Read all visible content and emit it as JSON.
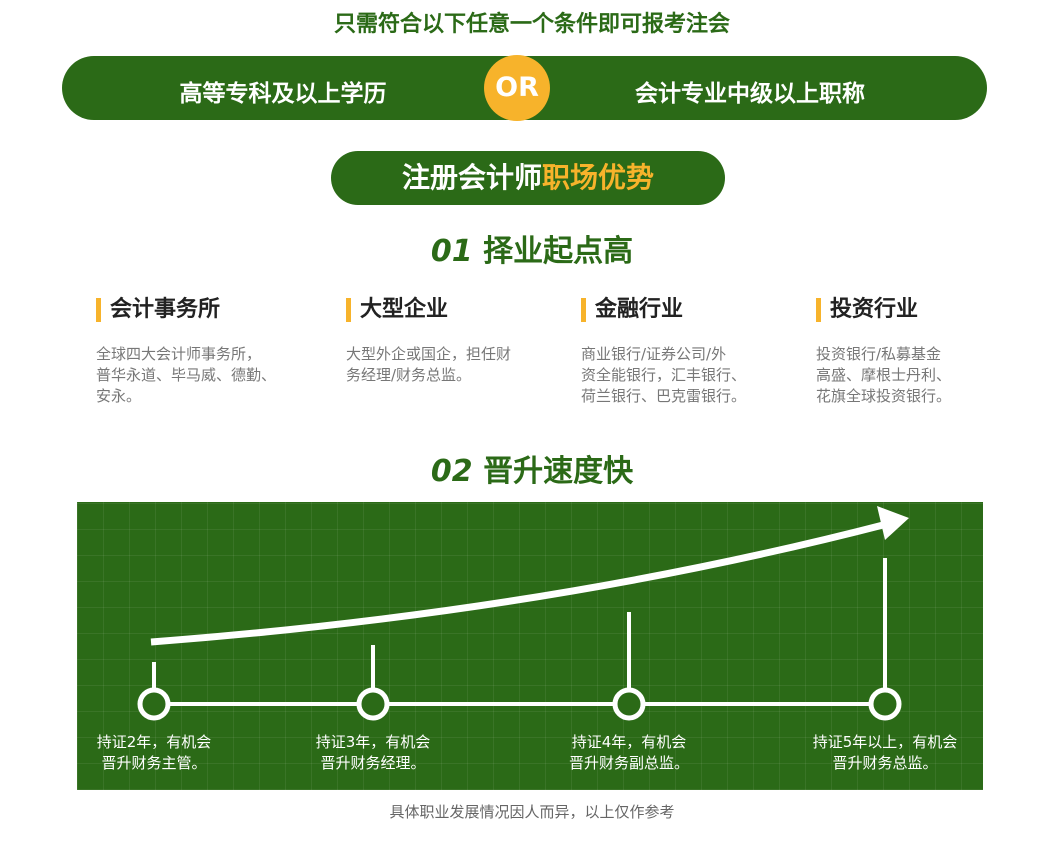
{
  "conditions": {
    "intro": "只需符合以下任意一个条件即可报考注会",
    "left": "高等专科及以上学历",
    "or": "OR",
    "right": "会计专业中级以上职称"
  },
  "section": {
    "pill_white": "注册会计师",
    "pill_yellow": "职场优势"
  },
  "advantage1": {
    "num": "01",
    "title": "择业起点高",
    "columns": [
      {
        "title": "会计事务所",
        "desc": [
          "全球四大会计师事务所，",
          "普华永道、毕马威、德勤、",
          "安永。"
        ]
      },
      {
        "title": "大型企业",
        "desc": [
          "大型外企或国企，担任财",
          "务经理/财务总监。"
        ]
      },
      {
        "title": "金融行业",
        "desc": [
          "商业银行/证券公司/外",
          "资全能银行，汇丰银行、",
          "荷兰银行、巴克雷银行。"
        ]
      },
      {
        "title": "投资行业",
        "desc": [
          "投资银行/私募基金",
          "高盛、摩根士丹利、",
          "花旗全球投资银行。"
        ]
      }
    ]
  },
  "advantage2": {
    "num": "02",
    "title": "晋升速度快",
    "stages": [
      {
        "line1": "持证2年，有机会",
        "line2": "晋升财务主管。"
      },
      {
        "line1": "持证3年，有机会",
        "line2": "晋升财务经理。"
      },
      {
        "line1": "持证4年，有机会",
        "line2": "晋升财务副总监。"
      },
      {
        "line1": "持证5年以上，有机会",
        "line2": "晋升财务总监。"
      }
    ]
  },
  "footnote": "具体职业发展情况因人而异，以上仅作参考",
  "colors": {
    "green": "#2b6a17",
    "yellow": "#f7b32b"
  }
}
